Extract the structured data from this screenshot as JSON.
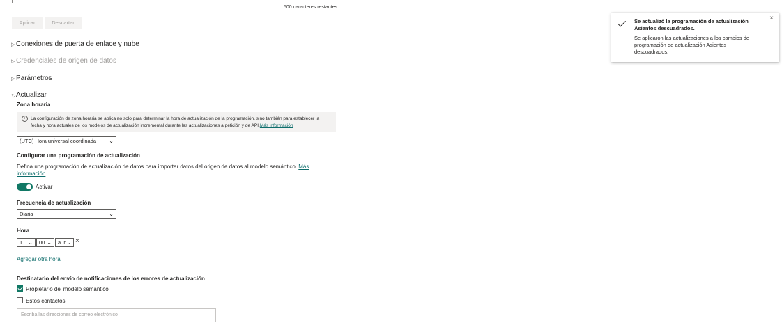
{
  "description": {
    "chars_remaining": "500 caracteres restantes"
  },
  "actions": {
    "apply_label": "Aplicar",
    "discard_label": "Descartar"
  },
  "sections": {
    "gateway": "Conexiones de puerta de enlace y nube",
    "credentials": "Credenciales de origen de datos",
    "parameters": "Parámetros",
    "refresh": "Actualizar"
  },
  "refresh": {
    "timezone_label": "Zona horaria",
    "timezone_info": "La configuración de zona horaria se aplica no solo para determinar la hora de actualización de la programación, sino también para establecer la fecha y hora actuales de los modelos de actualización incremental durante las actualizaciones a petición y de API.",
    "more_info": "Más información",
    "timezone_value": "(UTC) Hora universal coordinada",
    "schedule_label": "Configurar una programación de actualización",
    "schedule_desc": "Defina una programación de actualización de datos para importar datos del origen de datos al modelo semántico.",
    "schedule_more_info_1": "Más",
    "schedule_more_info_2": "información",
    "toggle_label": "Activar",
    "toggle_on": true,
    "frequency_label": "Frecuencia de actualización",
    "frequency_value": "Diaria",
    "time_label": "Hora",
    "hour_value": "1",
    "minute_value": "00",
    "ampm_value": "a. m.",
    "remove_time": "×",
    "add_time": "Agregar otra hora",
    "notify_label": "Destinatario del envío de notificaciones de los errores de actualización",
    "owner_label": "Propietario del modelo semántico",
    "owner_checked": true,
    "contacts_label": "Estos contactos:",
    "contacts_checked": false,
    "email_placeholder": "Escriba las direcciones de correo electrónico"
  },
  "toast": {
    "title": "Se actualizó la programación de actualización Asientos descuadrados.",
    "body": "Se aplicaron las actualizaciones a los cambios de programación de actualización Asientos descuadrados.",
    "close": "×"
  },
  "colors": {
    "accent": "#117865",
    "link": "#0e6d6b"
  }
}
